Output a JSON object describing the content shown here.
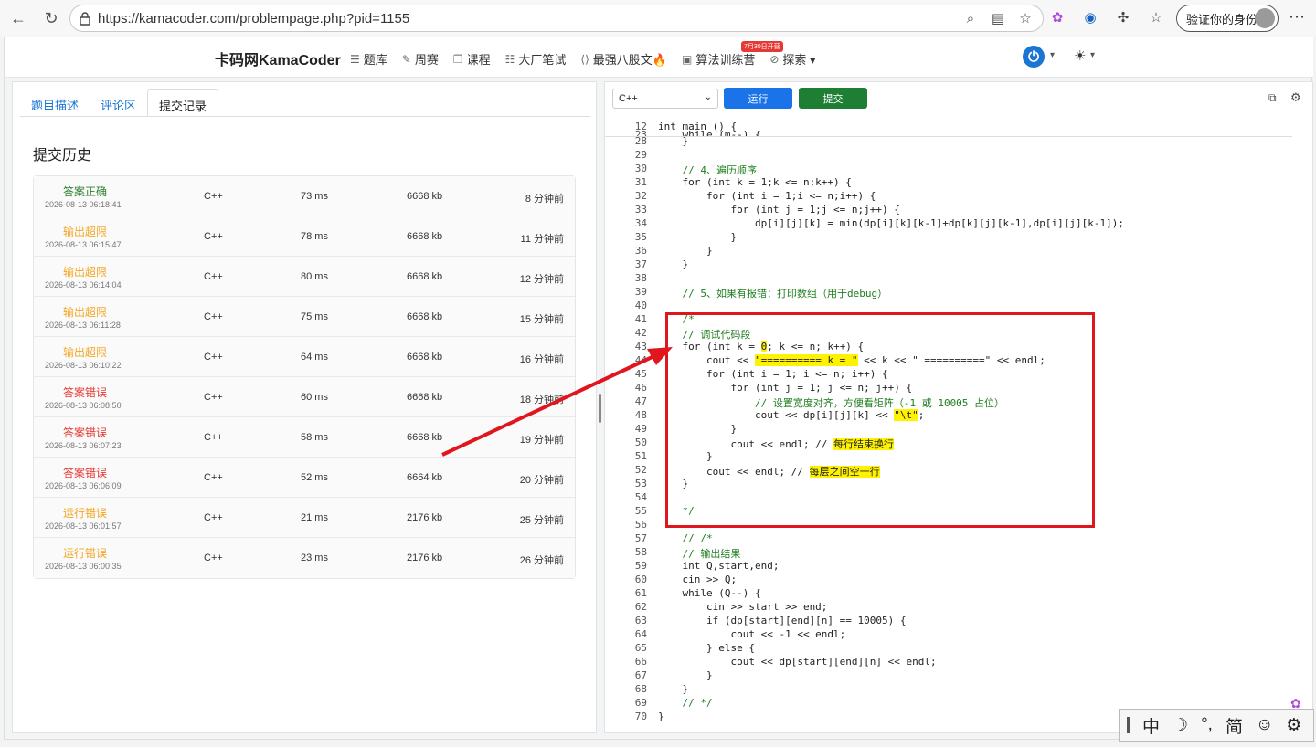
{
  "browser": {
    "url": "https://kamacoder.com/problempage.php?pid=1155",
    "profile_label": "验证你的身份"
  },
  "site": {
    "brand": "卡码网KamaCoder",
    "menu": [
      {
        "icon": "list-icon",
        "label": "题库"
      },
      {
        "icon": "pencil-icon",
        "label": "周赛"
      },
      {
        "icon": "book-icon",
        "label": "课程"
      },
      {
        "icon": "document-icon",
        "label": "大厂笔试"
      },
      {
        "icon": "code-icon",
        "label": "最强八股文🔥"
      },
      {
        "icon": "calendar-icon",
        "label": "算法训练营"
      },
      {
        "icon": "compass-icon",
        "label": "探索 ▾"
      }
    ],
    "badge": "7月30日开营"
  },
  "left": {
    "tabs": [
      "题目描述",
      "评论区",
      "提交记录"
    ],
    "active_tab": 2,
    "history_title": "提交历史",
    "submissions": [
      {
        "status": "答案正确",
        "kind": "ok",
        "time": "2026-08-13 06:18:41",
        "lang": "C++",
        "runtime": "73 ms",
        "memory": "6668 kb",
        "ago": "8 分钟前"
      },
      {
        "status": "输出超限",
        "kind": "warn",
        "time": "2026-08-13 06:15:47",
        "lang": "C++",
        "runtime": "78 ms",
        "memory": "6668 kb",
        "ago": "11 分钟前"
      },
      {
        "status": "输出超限",
        "kind": "warn",
        "time": "2026-08-13 06:14:04",
        "lang": "C++",
        "runtime": "80 ms",
        "memory": "6668 kb",
        "ago": "12 分钟前"
      },
      {
        "status": "输出超限",
        "kind": "warn",
        "time": "2026-08-13 06:11:28",
        "lang": "C++",
        "runtime": "75 ms",
        "memory": "6668 kb",
        "ago": "15 分钟前"
      },
      {
        "status": "输出超限",
        "kind": "warn",
        "time": "2026-08-13 06:10:22",
        "lang": "C++",
        "runtime": "64 ms",
        "memory": "6668 kb",
        "ago": "16 分钟前"
      },
      {
        "status": "答案错误",
        "kind": "err",
        "time": "2026-08-13 06:08:50",
        "lang": "C++",
        "runtime": "60 ms",
        "memory": "6668 kb",
        "ago": "18 分钟前"
      },
      {
        "status": "答案错误",
        "kind": "err",
        "time": "2026-08-13 06:07:23",
        "lang": "C++",
        "runtime": "58 ms",
        "memory": "6668 kb",
        "ago": "19 分钟前"
      },
      {
        "status": "答案错误",
        "kind": "err",
        "time": "2026-08-13 06:06:09",
        "lang": "C++",
        "runtime": "52 ms",
        "memory": "6664 kb",
        "ago": "20 分钟前"
      },
      {
        "status": "运行错误",
        "kind": "warn",
        "time": "2026-08-13 06:01:57",
        "lang": "C++",
        "runtime": "21 ms",
        "memory": "2176 kb",
        "ago": "25 分钟前"
      },
      {
        "status": "运行错误",
        "kind": "warn",
        "time": "2026-08-13 06:00:35",
        "lang": "C++",
        "runtime": "23 ms",
        "memory": "2176 kb",
        "ago": "26 分钟前"
      }
    ]
  },
  "editor": {
    "language": "C++",
    "run_label": "运行",
    "submit_label": "提交",
    "sticky": [
      {
        "n": "12",
        "code": "int main () {"
      },
      {
        "n": "23",
        "code": "    while (m--) {"
      }
    ],
    "lines": [
      {
        "n": "28",
        "code": "    }"
      },
      {
        "n": "29",
        "code": ""
      },
      {
        "n": "30",
        "code": "    // 4、遍历顺序"
      },
      {
        "n": "31",
        "code": "    for (int k = 1;k <= n;k++) {"
      },
      {
        "n": "32",
        "code": "        for (int i = 1;i <= n;i++) {"
      },
      {
        "n": "33",
        "code": "            for (int j = 1;j <= n;j++) {"
      },
      {
        "n": "34",
        "code": "                dp[i][j][k] = min(dp[i][k][k-1]+dp[k][j][k-1],dp[i][j][k-1]);"
      },
      {
        "n": "35",
        "code": "            }"
      },
      {
        "n": "36",
        "code": "        }"
      },
      {
        "n": "37",
        "code": "    }"
      },
      {
        "n": "38",
        "code": ""
      },
      {
        "n": "39",
        "code": "    // 5、如果有报错：打印数组（用于debug）"
      },
      {
        "n": "40",
        "code": ""
      },
      {
        "n": "41",
        "code": "    /*"
      },
      {
        "n": "42",
        "code": "    // 调试代码段"
      },
      {
        "n": "43",
        "code": "    for (int k = 0; k <= n; k++) {"
      },
      {
        "n": "44",
        "code": "        cout << \"========== k = \" << k << \" ==========\" << endl;"
      },
      {
        "n": "45",
        "code": "        for (int i = 1; i <= n; i++) {"
      },
      {
        "n": "46",
        "code": "            for (int j = 1; j <= n; j++) {"
      },
      {
        "n": "47",
        "code": "                // 设置宽度对齐，方便看矩阵（-1 或 10005 占位）"
      },
      {
        "n": "48",
        "code": "                cout << dp[i][j][k] << \"\\t\";"
      },
      {
        "n": "49",
        "code": "            }"
      },
      {
        "n": "50",
        "code": "            cout << endl; // 每行结束换行"
      },
      {
        "n": "51",
        "code": "        }"
      },
      {
        "n": "52",
        "code": "        cout << endl; // 每层之间空一行"
      },
      {
        "n": "53",
        "code": "    }"
      },
      {
        "n": "54",
        "code": ""
      },
      {
        "n": "55",
        "code": "    */"
      },
      {
        "n": "56",
        "code": ""
      },
      {
        "n": "57",
        "code": "    // /*"
      },
      {
        "n": "58",
        "code": "    // 输出结果"
      },
      {
        "n": "59",
        "code": "    int Q,start,end;"
      },
      {
        "n": "60",
        "code": "    cin >> Q;"
      },
      {
        "n": "61",
        "code": "    while (Q--) {"
      },
      {
        "n": "62",
        "code": "        cin >> start >> end;"
      },
      {
        "n": "63",
        "code": "        if (dp[start][end][n] == 10005) {"
      },
      {
        "n": "64",
        "code": "            cout << -1 << endl;"
      },
      {
        "n": "65",
        "code": "        } else {"
      },
      {
        "n": "66",
        "code": "            cout << dp[start][end][n] << endl;"
      },
      {
        "n": "67",
        "code": "        }"
      },
      {
        "n": "68",
        "code": "    }"
      },
      {
        "n": "69",
        "code": "    // */"
      },
      {
        "n": "70",
        "code": "}"
      }
    ]
  },
  "ime": {
    "items": [
      "中",
      "☽",
      "°,",
      "简",
      "☺",
      "⚙"
    ]
  },
  "colors": {
    "accent": "#1a73e8",
    "submit": "#1e7e34",
    "annotation": "#e0161f",
    "highlight": "#fff200"
  }
}
